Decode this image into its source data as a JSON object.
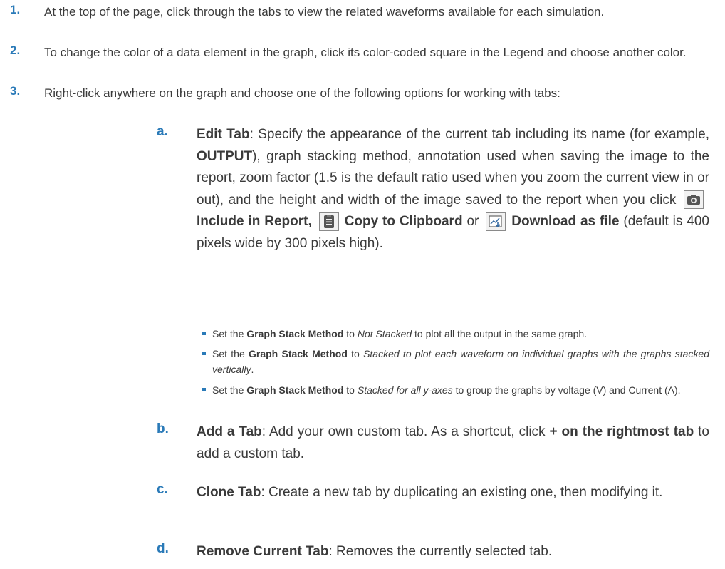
{
  "steps": [
    {
      "num": "1.",
      "text": "At the top of the page, click through the tabs to view the related waveforms available for each simulation."
    },
    {
      "num": "2.",
      "text": "To change the color of a data element in the graph, click its color-coded square in the Legend and choose another color."
    },
    {
      "num": "3.",
      "text": "Right-click anywhere on the graph and choose one of the following options for working with tabs:"
    }
  ],
  "sub_a": {
    "letter": "a.",
    "label": "Edit Tab",
    "p1": ": Specify the appearance of the current tab including its name (for example, ",
    "output": "OUTPUT",
    "p2": "), graph stacking method, annotation used when saving the image to the report, zoom factor (1.5 is the default ratio used when you zoom the current view in or out), and the height and width of the image",
    "p3": "saved to the report when you click",
    "include": "Include in Report,",
    "copy": "Copy to Clipboard",
    "or": " or ",
    "download": "Download as file",
    "p4": " (default is 400 pixels wide by 300 pixels high).",
    "icons": [
      "camera-icon",
      "clipboard-icon",
      "download-icon"
    ]
  },
  "bullets": [
    {
      "pre": "Set the ",
      "bold": "Graph Stack Method",
      "mid": " to ",
      "ital": "Not Stacked",
      "post": " to plot all the output in the same graph."
    },
    {
      "pre": "Set the ",
      "bold": "Graph Stack Method",
      "mid": " to ",
      "ital": "Stacked to plot each waveform on individual graphs with the graphs stacked vertically",
      "post": "."
    },
    {
      "pre": "Set the ",
      "bold": "Graph Stack Method",
      "mid": " to ",
      "ital": "Stacked for all y-axes",
      "post": " to group the graphs by voltage (V) and Current (A)."
    }
  ],
  "sub_b": {
    "letter": "b.",
    "label": "Add a Tab",
    "p1": ": Add your own custom tab. As a shortcut, click ",
    "bold": "+ on the rightmost tab",
    "p2": " to add a custom tab."
  },
  "sub_c": {
    "letter": "c.",
    "label": "Clone Tab",
    "p1": ": Create a new tab by duplicating an existing one, then modifying it."
  },
  "sub_d": {
    "letter": "d.",
    "label": "Remove Current Tab",
    "p1": ": Removes the currently selected tab."
  },
  "colors": {
    "accent": "#2a7ab8",
    "text": "#3a3a3a"
  }
}
